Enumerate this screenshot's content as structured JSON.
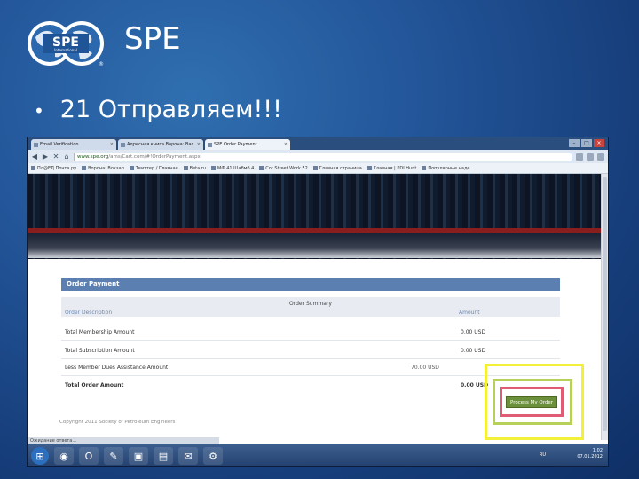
{
  "slide": {
    "logo_text": "SPE",
    "logo_subtext": "International",
    "logo_mark": "®",
    "title": "SPE",
    "bullet_symbol": "•",
    "bullet": "21 Отправляем!!!"
  },
  "browser": {
    "tabs": [
      {
        "label": "Email Verification",
        "close": "×"
      },
      {
        "label": "Адресная книга Ворона: Вас",
        "close": "×"
      },
      {
        "label": "SPE Order Payment",
        "close": "×"
      }
    ],
    "window_controls": {
      "minimize": "–",
      "maximize": "□",
      "close": "×"
    },
    "nav": {
      "back": "◀",
      "forward": "▶",
      "reload": "✕",
      "home": "⌂"
    },
    "url_host": "www.spe.org",
    "url_path": "/ams/Cart.com/#!OrderPayment.aspx",
    "bookmarks": [
      "Пл@ЕД Почта.ру",
      "Ворона: Вокзал",
      "Твиттер / Главная",
      "Beta.ru",
      "МФ 41 Шабмб 4",
      "Cot Street Work 52",
      "Главная страница",
      "Главная | PDI Hunt",
      "Популярные наде..."
    ]
  },
  "order": {
    "header": "Order Payment",
    "summary_title": "Order Summary",
    "col_description": "Order Description",
    "col_amount": "Amount",
    "rows": [
      {
        "label": "Total Membership Amount",
        "middle": "",
        "value": "0.00 USD"
      },
      {
        "label": "Total Subscription Amount",
        "middle": "",
        "value": "0.00 USD"
      },
      {
        "label": "Less Member Dues Assistance Amount",
        "middle": "70.00 USD",
        "value": ""
      },
      {
        "label": "Total Order Amount",
        "middle": "",
        "value": "0.00 USD"
      }
    ],
    "process_button": "Process My Order",
    "copyright": "Copyright 2011 Society of Petroleum Engineers",
    "status": "Ожидание ответа..."
  },
  "taskbar": {
    "apps": [
      "⊞",
      "◉",
      "O",
      "✎",
      "▣",
      "▤",
      "✉",
      "⚙"
    ],
    "lang": "RU",
    "time": "1:02",
    "date": "07.01.2012"
  },
  "colors": {
    "order_header": "#5c7fb1",
    "process_button": "#6b8f3a",
    "highlight_yellow": "#f3f03a",
    "highlight_green": "#b7d05a",
    "highlight_red": "#e05c74"
  }
}
